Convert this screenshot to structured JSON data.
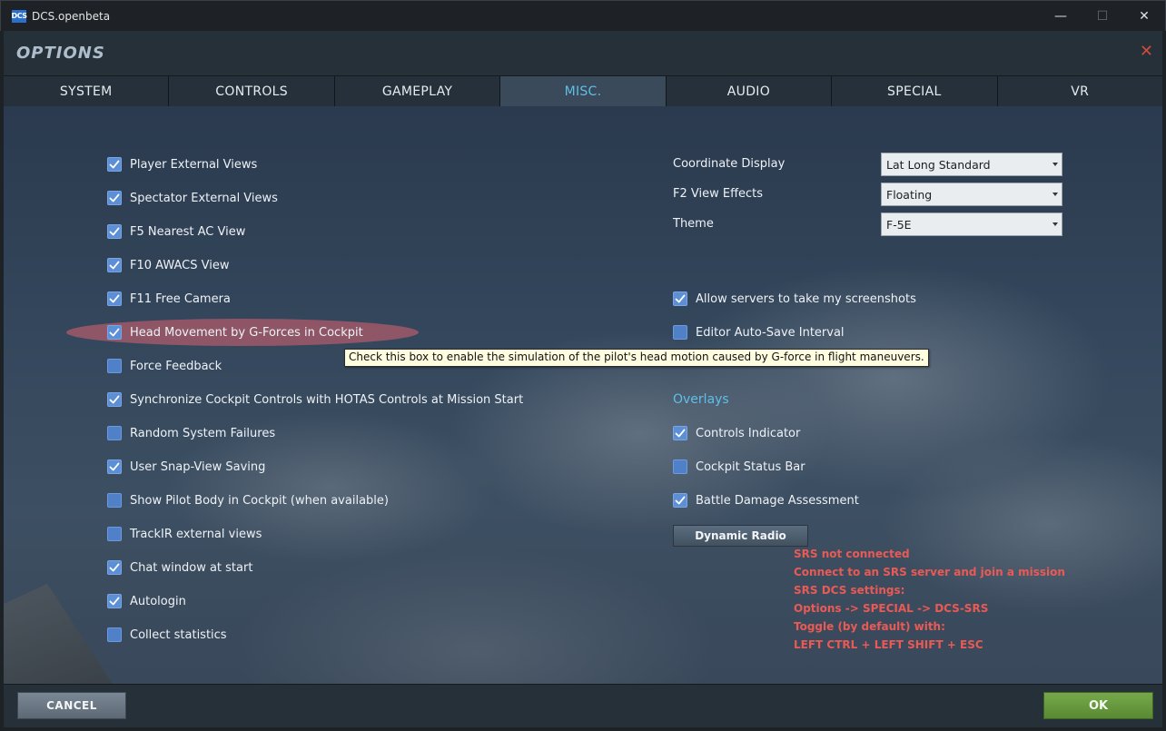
{
  "window": {
    "app_icon_text": "DCS",
    "title": "DCS.openbeta",
    "minimize_glyph": "—",
    "maximize_glyph": "☐",
    "close_glyph": "✕"
  },
  "options": {
    "title": "OPTIONS",
    "close_glyph": "✕"
  },
  "tabs": [
    {
      "label": "SYSTEM",
      "active": false
    },
    {
      "label": "CONTROLS",
      "active": false
    },
    {
      "label": "GAMEPLAY",
      "active": false
    },
    {
      "label": "MISC.",
      "active": true
    },
    {
      "label": "AUDIO",
      "active": false
    },
    {
      "label": "SPECIAL",
      "active": false
    },
    {
      "label": "VR",
      "active": false
    }
  ],
  "left_checkboxes": [
    {
      "label": "Player External Views",
      "checked": true
    },
    {
      "label": "Spectator External Views",
      "checked": true
    },
    {
      "label": "F5 Nearest AC View",
      "checked": true
    },
    {
      "label": "F10 AWACS View",
      "checked": true
    },
    {
      "label": "F11 Free Camera",
      "checked": true
    },
    {
      "label": "Head Movement by G-Forces in Cockpit",
      "checked": true
    },
    {
      "label": "Force Feedback",
      "checked": false
    },
    {
      "label": "Synchronize Cockpit Controls with HOTAS Controls at Mission Start",
      "checked": true
    },
    {
      "label": "Random System Failures",
      "checked": false
    },
    {
      "label": "User Snap-View Saving",
      "checked": true
    },
    {
      "label": "Show Pilot Body in Cockpit (when available)",
      "checked": false
    },
    {
      "label": "TrackIR external views",
      "checked": false
    },
    {
      "label": "Chat window at start",
      "checked": true
    },
    {
      "label": "Autologin",
      "checked": true
    },
    {
      "label": "Collect statistics",
      "checked": false
    }
  ],
  "right_fields": [
    {
      "label": "Coordinate Display",
      "value": "Lat Long Standard"
    },
    {
      "label": "F2 View Effects",
      "value": "Floating"
    },
    {
      "label": "Theme",
      "value": "F-5E"
    }
  ],
  "right_checkboxes": [
    {
      "label": "Allow servers to take my screenshots",
      "checked": true
    },
    {
      "label": "Editor Auto-Save Interval",
      "checked": false
    }
  ],
  "tooltip": {
    "text": "Check this box to enable the simulation of the pilot's head motion caused by G-force in flight maneuvers.",
    "peek_text": "in"
  },
  "overlays": {
    "heading": "Overlays",
    "checkboxes": [
      {
        "label": "Controls Indicator",
        "checked": true
      },
      {
        "label": "Cockpit Status Bar",
        "checked": false
      },
      {
        "label": "Battle Damage Assessment",
        "checked": true
      }
    ]
  },
  "dynamic_radio": {
    "button_label": "Dynamic Radio",
    "status_lines": [
      "SRS not connected",
      "Connect to an SRS server and join a mission",
      "SRS DCS settings:",
      "Options -> SPECIAL -> DCS-SRS",
      "Toggle (by default) with:",
      "LEFT CTRL + LEFT SHIFT + ESC"
    ]
  },
  "footer": {
    "cancel_label": "CANCEL",
    "ok_label": "OK"
  },
  "colors": {
    "accent": "#5ebfe8",
    "ok_green": "#6a9a3e",
    "srs_red": "#ea5a55",
    "checkbox_blue": "#5c8fd6"
  }
}
